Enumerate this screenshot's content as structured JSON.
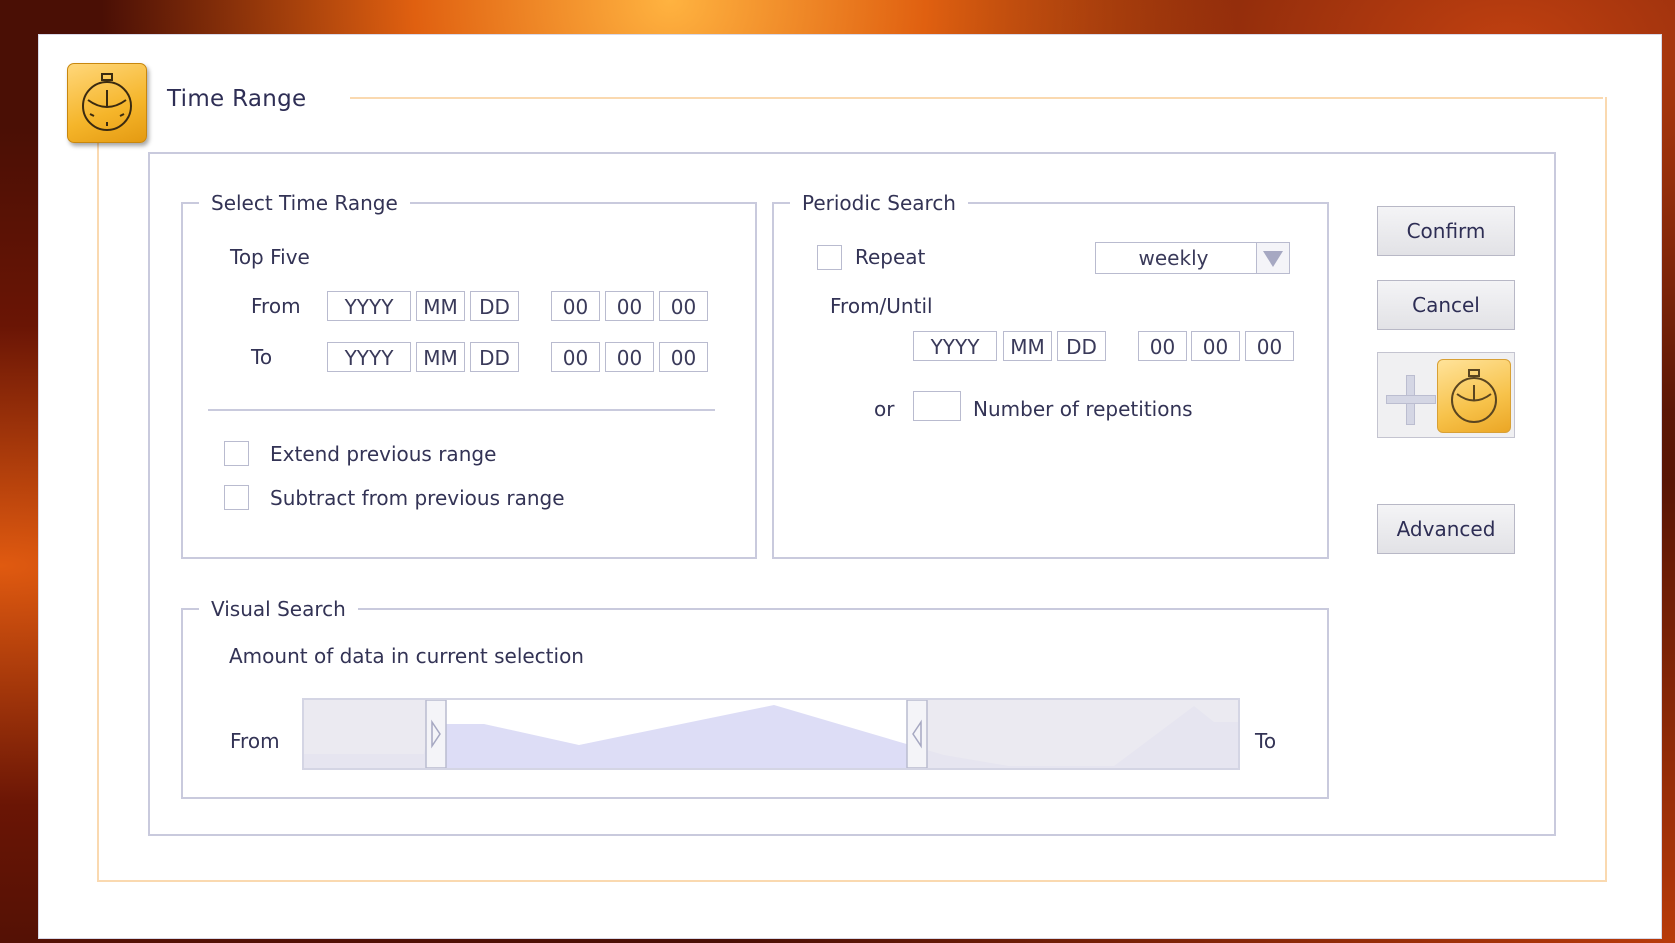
{
  "window": {
    "title": "Time Range",
    "icon": "stopwatch-icon"
  },
  "select_time_range": {
    "legend": "Select Time Range",
    "top_five": "Top Five",
    "from_label": "From",
    "to_label": "To",
    "date_placeholders": {
      "year": "YYYY",
      "month": "MM",
      "day": "DD"
    },
    "time_values": {
      "hour": "00",
      "minute": "00",
      "second": "00"
    },
    "extend_label": "Extend previous range",
    "subtract_label": "Subtract from previous range"
  },
  "periodic_search": {
    "legend": "Periodic Search",
    "repeat_label": "Repeat",
    "frequency": "weekly",
    "from_until_label": "From/Until",
    "date_placeholders": {
      "year": "YYYY",
      "month": "MM",
      "day": "DD"
    },
    "time_values": {
      "hour": "00",
      "minute": "00",
      "second": "00"
    },
    "or_label": "or",
    "repetitions_label": "Number of repetitions"
  },
  "buttons": {
    "confirm": "Confirm",
    "cancel": "Cancel",
    "advanced": "Advanced",
    "add_clock_icons": [
      "plus-icon",
      "stopwatch-icon"
    ]
  },
  "visual_search": {
    "legend": "Visual Search",
    "description": "Amount of data in current selection",
    "from_label": "From",
    "to_label": "To",
    "selection_range": [
      0.131,
      0.667
    ],
    "colors": {
      "area": "#ddddf6",
      "handle_shade": "#e8e6ee"
    }
  },
  "colors": {
    "accent_orange": "#f5b52a",
    "frame_peach": "#fad9b0",
    "border_gray": "#c9cadd"
  }
}
